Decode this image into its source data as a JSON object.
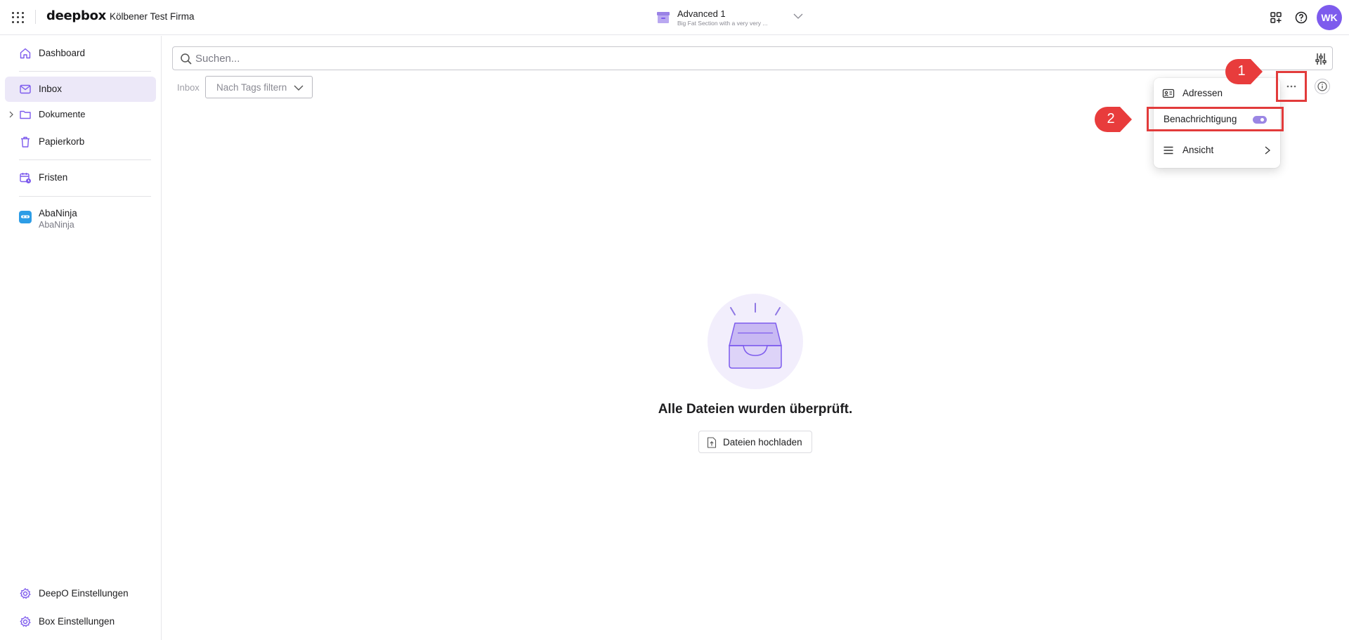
{
  "topbar": {
    "logo": "deepbox",
    "company": "Kölbener Test Firma",
    "box_title": "Advanced 1",
    "box_subtitle": "Big Fat Section with a very very ...",
    "avatar_initials": "WK",
    "avatar_color": "#7d5bed"
  },
  "sidebar": {
    "items": [
      {
        "label": "Dashboard",
        "icon": "home-icon"
      },
      {
        "label": "Inbox",
        "icon": "mail-icon",
        "active": true
      },
      {
        "label": "Dokumente",
        "icon": "folder-icon"
      },
      {
        "label": "Papierkorb",
        "icon": "trash-icon"
      },
      {
        "label": "Fristen",
        "icon": "calendar-clock-icon"
      },
      {
        "label": "AbaNinja",
        "sublabel": "AbaNinja",
        "icon": "abaninja-icon"
      }
    ],
    "bottom": [
      {
        "label": "DeepO Einstellungen",
        "icon": "gear-icon"
      },
      {
        "label": "Box Einstellungen",
        "icon": "gear-icon"
      }
    ]
  },
  "search": {
    "placeholder": "Suchen..."
  },
  "toolbar": {
    "breadcrumb": "Inbox",
    "tags_filter": "Nach Tags filtern"
  },
  "menu": {
    "items": [
      {
        "label": "Adressen",
        "icon": "address-card-icon"
      },
      {
        "label": "Benachrichtigung",
        "toggle": true
      },
      {
        "label": "Ansicht",
        "icon": "list-icon",
        "submenu": true
      }
    ]
  },
  "annotations": {
    "callout_1": "1",
    "callout_2": "2",
    "highlight_color": "#e23b3b"
  },
  "empty_state": {
    "title": "Alle Dateien wurden überprüft.",
    "upload_label": "Dateien hochladen"
  },
  "colors": {
    "accent": "#7d5bed",
    "active_nav_bg": "#ece8f8",
    "toggle_on": "#9b86e4"
  }
}
